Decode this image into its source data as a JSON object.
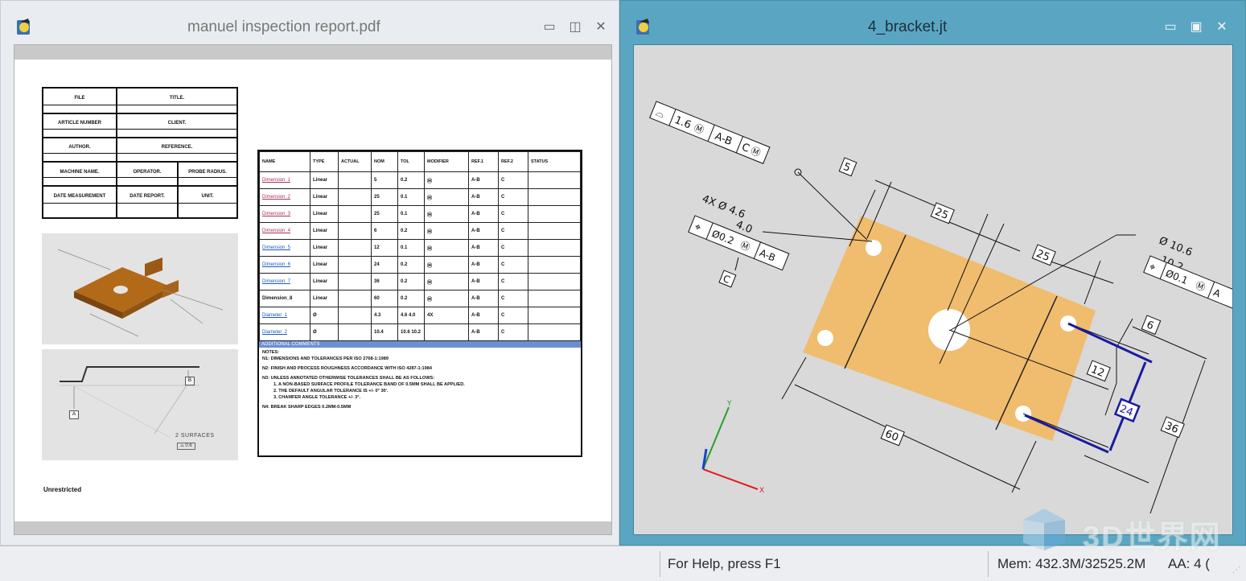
{
  "left_window": {
    "title": "manuel inspection report.pdf",
    "buttons": {
      "minimize": "▭",
      "restore": "◫",
      "close": "✕"
    }
  },
  "right_window": {
    "title": "4_bracket.jt",
    "buttons": {
      "minimize": "▭",
      "restore": "▣",
      "close": "✕"
    }
  },
  "report": {
    "header": {
      "file": "FILE",
      "title": "TITLE.",
      "article_number": "ARTICLE NUMBER",
      "client": "CLIENT.",
      "author": "AUTHOR.",
      "reference": "REFERENCE.",
      "machine_name": "MACHINE NAME.",
      "operator": "OPERATOR.",
      "probe_radius": "PROBE RADIUS.",
      "date_measurement": "DATE MEASUREMENT",
      "date_report": "DATE REPORT.",
      "unit": "UNIT."
    },
    "columns": [
      "NAME",
      "TYPE",
      "ACTUAL",
      "NOM",
      "TOL",
      "MODIFIER",
      "REF.1",
      "REF.2",
      "STATUS"
    ],
    "rows": [
      {
        "name": "Dimension_1",
        "type": "Linear",
        "actual": "",
        "nom": "5",
        "tol": "0.2",
        "modifier": "Ⓜ",
        "ref1": "A-B",
        "ref2": "C",
        "status": ""
      },
      {
        "name": "Dimension_2",
        "type": "Linear",
        "actual": "",
        "nom": "25",
        "tol": "0.1",
        "modifier": "Ⓜ",
        "ref1": "A-B",
        "ref2": "C",
        "status": ""
      },
      {
        "name": "Dimension_3",
        "type": "Linear",
        "actual": "",
        "nom": "25",
        "tol": "0.1",
        "modifier": "Ⓜ",
        "ref1": "A-B",
        "ref2": "C",
        "status": ""
      },
      {
        "name": "Dimension_4",
        "type": "Linear",
        "actual": "",
        "nom": "6",
        "tol": "0.2",
        "modifier": "Ⓜ",
        "ref1": "A-B",
        "ref2": "C",
        "status": ""
      },
      {
        "name": "Dimension_5",
        "type": "Linear",
        "actual": "",
        "nom": "12",
        "tol": "0.1",
        "modifier": "Ⓜ",
        "ref1": "A-B",
        "ref2": "C",
        "status": ""
      },
      {
        "name": "Dimension_6",
        "type": "Linear",
        "actual": "",
        "nom": "24",
        "tol": "0.2",
        "modifier": "Ⓜ",
        "ref1": "A-B",
        "ref2": "C",
        "status": ""
      },
      {
        "name": "Dimension_7",
        "type": "Linear",
        "actual": "",
        "nom": "36",
        "tol": "0.2",
        "modifier": "Ⓜ",
        "ref1": "A-B",
        "ref2": "C",
        "status": ""
      },
      {
        "name": "Dimension_8",
        "type": "Linear",
        "actual": "",
        "nom": "60",
        "tol": "0.2",
        "modifier": "Ⓜ",
        "ref1": "A-B",
        "ref2": "C",
        "status": ""
      },
      {
        "name": "Diameter_1",
        "type": "Ø",
        "actual": "",
        "nom": "4.3",
        "tol": "4.6 4.0",
        "modifier": "4X",
        "ref1": "A-B",
        "ref2": "C",
        "status": ""
      },
      {
        "name": "Diameter_2",
        "type": "Ø",
        "actual": "",
        "nom": "10.4",
        "tol": "10.6 10.2",
        "modifier": "",
        "ref1": "A-B",
        "ref2": "C",
        "status": ""
      }
    ],
    "comments_header": "ADDITIONAL COMMENTS",
    "notes_title": "NOTES:",
    "notes": [
      "N1: DIMENSIONS AND TOLERANCES PER ISO 2768-1:1989",
      "N2: FINISH AND PROCESS ROUGHNESS ACCORDANCE WITH ISO 4287-1:1984",
      "N3: UNLESS ANNOTATED OTHERWISE TOLERANCES SHALL BE AS FOLLOWS:",
      "1. A NON-BASED SURFACE PROFILE TOLERANCE BAND OF 0.5MM SHALL BE APPLIED.",
      "2. THE DEFAULT ANGULAR TOLERANCE IS +/- 0° 30'.",
      "3. CHAMFER ANGLE TOLERANCE +/- 3°.",
      "N4: BREAK SHARP EDGES 0.2MM-0.5MM"
    ],
    "footer": "Unrestricted",
    "thumb2_label": "2 SURFACES",
    "thumb2_value": "0.6",
    "thumb2_datum_a": "A",
    "thumb2_datum_b": "B"
  },
  "viewer": {
    "fcf_top": {
      "tol": "1.6",
      "mod": "Ⓜ",
      "ref1": "A-B",
      "ref2": "C",
      "mod2": "Ⓜ"
    },
    "dim_5": "5",
    "dim_25a": "25",
    "dim_25b": "25",
    "hole_callout": {
      "count": "4X",
      "diam": "Ø",
      "upper": "4.6",
      "lower": "4.0",
      "tol": "Ø0.2",
      "mod": "Ⓜ",
      "ref": "A-B",
      "datum": "C"
    },
    "big_hole": {
      "diam": "Ø",
      "upper": "10.6",
      "lower": "10.2",
      "tol": "Ø0.1",
      "mod": "Ⓜ",
      "ref": "A"
    },
    "dim_6": "6",
    "dim_12": "12",
    "dim_24": "24",
    "dim_36": "36",
    "dim_60": "60",
    "axis_x": "X",
    "axis_y": "Y",
    "colors": {
      "part": "#f0bc6e",
      "highlight": "#1a1aa0",
      "axis_x": "#e02020",
      "axis_y": "#2aa02a",
      "axis_z": "#1c3fd0"
    }
  },
  "statusbar": {
    "help": "For Help, press F1",
    "mem": "Mem: 432.3M/32525.2M",
    "aa": "AA: 4 ("
  },
  "watermark": "3D世界网"
}
